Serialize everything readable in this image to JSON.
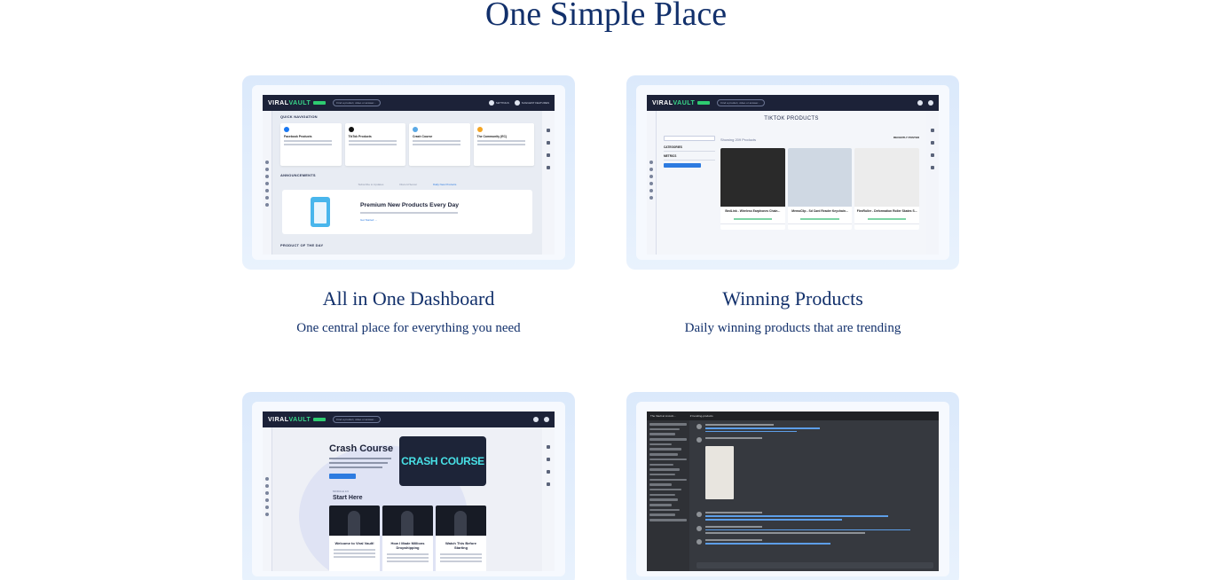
{
  "section": {
    "title": "One Simple Place"
  },
  "features": [
    {
      "title": "All in One Dashboard",
      "subtitle": "One central place for everything you need",
      "screen": {
        "logo_prefix": "VIRAL",
        "logo_suffix": "VAULT",
        "search_placeholder": "Find a product, video or answer...",
        "top_links": [
          "SETTINGS",
          "SUGGEST FEATURES"
        ],
        "quick_nav_label": "QUICK NAVIGATION",
        "nav_cards": [
          "Facebook Products",
          "TikTok Products",
          "Crash Course",
          "The Community (EC)"
        ],
        "announcements_label": "ANNOUNCEMENTS",
        "announcement_tabs": [
          "Subscribe to Updates",
          "Discord Server",
          "Daily New Products"
        ],
        "promo_title": "Premium New Products Every Day",
        "promo_link": "Get Started  →",
        "product_of_day_label": "PRODUCT OF THE DAY"
      }
    },
    {
      "title": "Winning Products",
      "subtitle": "Daily winning products that are trending",
      "screen": {
        "logo_prefix": "VIRAL",
        "logo_suffix": "VAULT",
        "search_placeholder": "Find a product, video or answer...",
        "heading": "TIKTOK PRODUCTS",
        "showing": "Showing  209 Products",
        "sort": "RECENTLY POSTED",
        "filters": [
          "CATEGORIES",
          "METRICS"
        ],
        "products": [
          "BedLink - Wireless Earphones Chain...",
          "MemoClip - Sd Card Reader Keychain...",
          "FlexRoller - Deformation Roller Skates S..."
        ],
        "product_colors": [
          "#2a2a2a",
          "#cfd8e3",
          "#ececec"
        ]
      }
    },
    {
      "title": "",
      "subtitle": "",
      "screen": {
        "logo_prefix": "VIRAL",
        "logo_suffix": "VAULT",
        "search_placeholder": "Find a product, video or answer...",
        "course_title": "Crash Course",
        "video_title": "CRASH COURSE",
        "module_label": "MODULE 1/3",
        "start_here": "Start Here",
        "lessons": [
          "Welcome to Viral Vault!",
          "How I Made Millions Dropshipping",
          "Watch This Before Starting"
        ]
      }
    },
    {
      "title": "",
      "subtitle": "",
      "screen": {
        "server_name": "The Vault at Lincoln...",
        "channel": "# trending-products"
      }
    }
  ]
}
